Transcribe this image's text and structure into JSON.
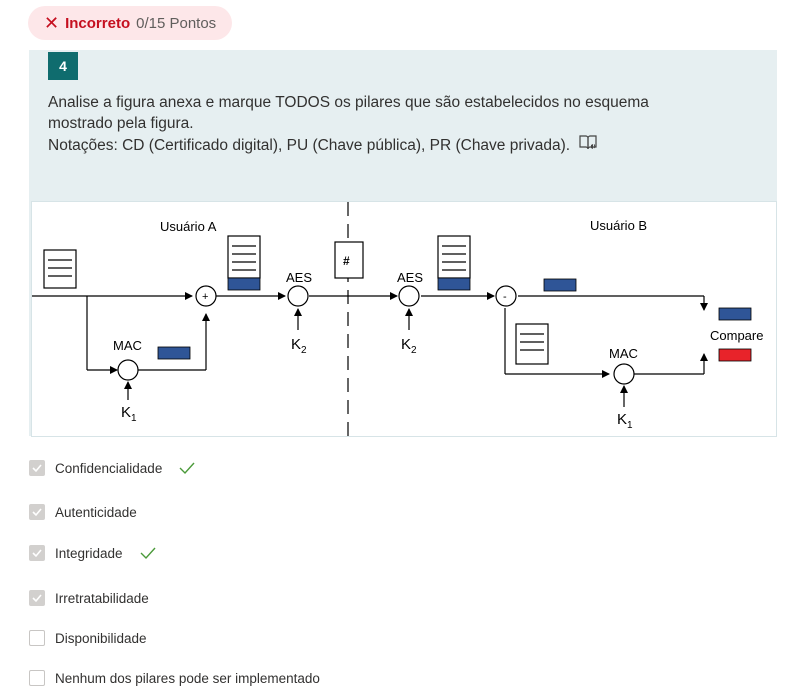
{
  "result": {
    "icon": "close-icon",
    "status": "Incorreto",
    "points": "0/15 Pontos"
  },
  "question": {
    "number": "4",
    "text_line1": "Analise a figura anexa e marque TODOS os pilares que são estabelecidos no esquema",
    "text_line2": "mostrado pela figura.",
    "text_line3": "Notações: CD (Certificado digital), PU (Chave pública), PR (Chave privada).",
    "reader_icon": "immersive-reader-icon"
  },
  "figure": {
    "user_a": "Usuário A",
    "user_b": "Usuário B",
    "aes": "AES",
    "mac": "MAC",
    "hash": "#",
    "plus": "+",
    "minus": "-",
    "compare": "Compare",
    "k1": "K",
    "k2": "K",
    "sub1": "1",
    "sub2": "2",
    "colors": {
      "blue": "#2f5597",
      "red": "#e8232a"
    }
  },
  "options": [
    {
      "label": "Confidencialidade",
      "checked": true,
      "correct": true
    },
    {
      "label": "Autenticidade",
      "checked": true,
      "correct": false
    },
    {
      "label": "Integridade",
      "checked": true,
      "correct": true
    },
    {
      "label": "Irretratabilidade",
      "checked": true,
      "correct": false
    },
    {
      "label": "Disponibilidade",
      "checked": false,
      "correct": false
    },
    {
      "label": "Nenhum dos pilares pode ser implementado",
      "checked": false,
      "correct": false
    }
  ]
}
